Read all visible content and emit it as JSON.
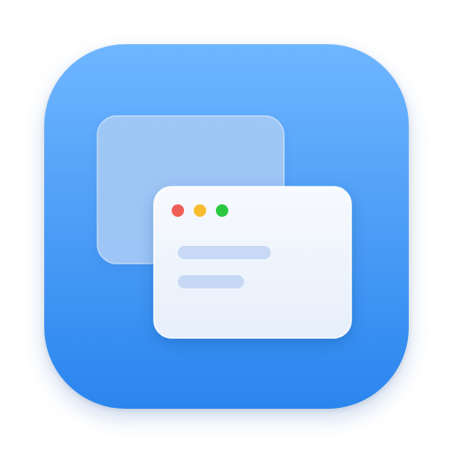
{
  "app_icon": {
    "icon_name": "window-manager-icon",
    "colors": {
      "background_top": "#6fb6ff",
      "background_bottom": "#2a85ee",
      "back_window": "#a9ccf6",
      "front_window_top": "#f7fafe",
      "front_window_bottom": "#e7effb",
      "text_line": "#c7d9f4",
      "close_dot": "#f05f57",
      "minimize_dot": "#f8bc2f",
      "zoom_dot": "#2bc840"
    }
  }
}
